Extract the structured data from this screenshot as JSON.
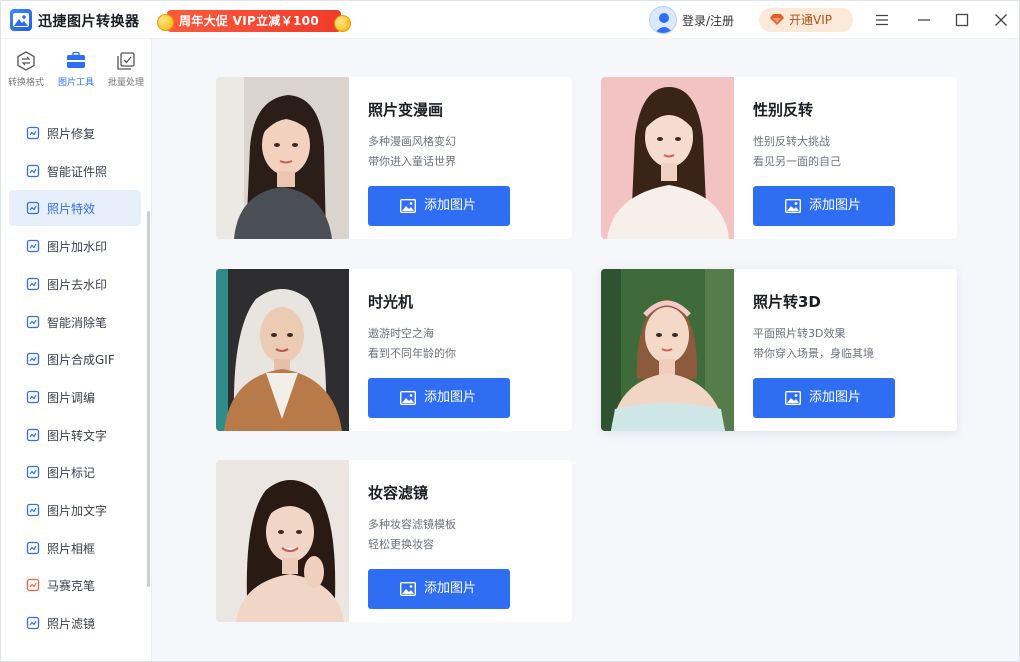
{
  "app": {
    "title": "迅捷图片转换器",
    "promo_text": "周年大促 VIP立减￥100",
    "login_label": "登录/注册",
    "vip_label": "开通VIP"
  },
  "colors": {
    "accent": "#2f6ef3",
    "promo": "#f03b2a",
    "vip_bg": "#fde9d8",
    "active_nav_bg": "#e8effc"
  },
  "sidebar": {
    "category_tabs": [
      {
        "label": "转换格式",
        "icon": "convert-icon"
      },
      {
        "label": "图片工具",
        "icon": "toolbox-icon"
      },
      {
        "label": "批量处理",
        "icon": "batch-icon"
      }
    ],
    "items": [
      {
        "label": "照片修复",
        "icon": "photo-repair-icon"
      },
      {
        "label": "智能证件照",
        "icon": "id-photo-icon"
      },
      {
        "label": "照片特效",
        "icon": "photo-effect-icon"
      },
      {
        "label": "图片加水印",
        "icon": "add-watermark-icon"
      },
      {
        "label": "图片去水印",
        "icon": "remove-watermark-icon"
      },
      {
        "label": "智能消除笔",
        "icon": "eraser-pen-icon"
      },
      {
        "label": "图片合成GIF",
        "icon": "gif-icon"
      },
      {
        "label": "图片调编",
        "icon": "adjust-icon"
      },
      {
        "label": "图片转文字",
        "icon": "ocr-icon"
      },
      {
        "label": "图片标记",
        "icon": "mark-icon"
      },
      {
        "label": "图片加文字",
        "icon": "add-text-icon"
      },
      {
        "label": "照片相框",
        "icon": "frame-icon"
      },
      {
        "label": "马赛克笔",
        "icon": "mosaic-icon"
      },
      {
        "label": "照片滤镜",
        "icon": "filter-icon"
      }
    ]
  },
  "cards": [
    {
      "title": "照片变漫画",
      "desc1": "多种漫画风格变幻",
      "desc2": "带你进入童话世界",
      "button": "添加图片"
    },
    {
      "title": "性别反转",
      "desc1": "性别反转大挑战",
      "desc2": "看见另一面的自己",
      "button": "添加图片"
    },
    {
      "title": "时光机",
      "desc1": "遨游时空之海",
      "desc2": "看到不同年龄的你",
      "button": "添加图片"
    },
    {
      "title": "照片转3D",
      "desc1": "平面照片转3D效果",
      "desc2": "带你穿入场景，身临其境",
      "button": "添加图片"
    },
    {
      "title": "妆容滤镜",
      "desc1": "多种妆容滤镜模板",
      "desc2": "轻松更换妆容",
      "button": "添加图片"
    }
  ]
}
